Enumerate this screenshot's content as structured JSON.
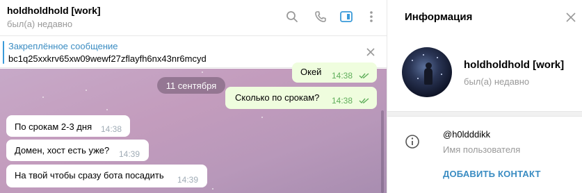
{
  "chat": {
    "title": "holdholdhold [work]",
    "status": "был(а) недавно",
    "pinned": {
      "title": "Закреплённое сообщение",
      "text": "bc1q25xxkrv65xw09wewf27zflayfh6nx43nr6mcyd"
    },
    "date_separator": "11 сентября",
    "messages": [
      {
        "direction": "out",
        "text": "Окей",
        "time": "14:38",
        "read": true
      },
      {
        "direction": "out",
        "text": "Сколько по срокам?",
        "time": "14:38",
        "read": true
      },
      {
        "direction": "in",
        "text": "По срокам 2-3 дня",
        "time": "14:38"
      },
      {
        "direction": "in",
        "text": "Домен, хост есть уже?",
        "time": "14:39"
      },
      {
        "direction": "in",
        "text": "На твой чтобы сразу бота посадить",
        "time": "14:39"
      }
    ]
  },
  "info_panel": {
    "title": "Информация",
    "profile": {
      "name": "holdholdhold [work]",
      "status": "был(а) недавно"
    },
    "username": "@h0ldddikk",
    "username_label": "Имя пользователя",
    "add_contact_label": "ДОБАВИТЬ КОНТАКТ"
  },
  "icons": [
    "search-icon",
    "phone-icon",
    "sidebar-toggle-icon",
    "more-vertical-icon",
    "close-icon",
    "info-icon",
    "double-check-icon"
  ],
  "colors": {
    "accent": "#3a9ad9",
    "outgoing_bubble": "#effdde",
    "incoming_bubble": "#ffffff",
    "read_check": "#5fae5a"
  }
}
